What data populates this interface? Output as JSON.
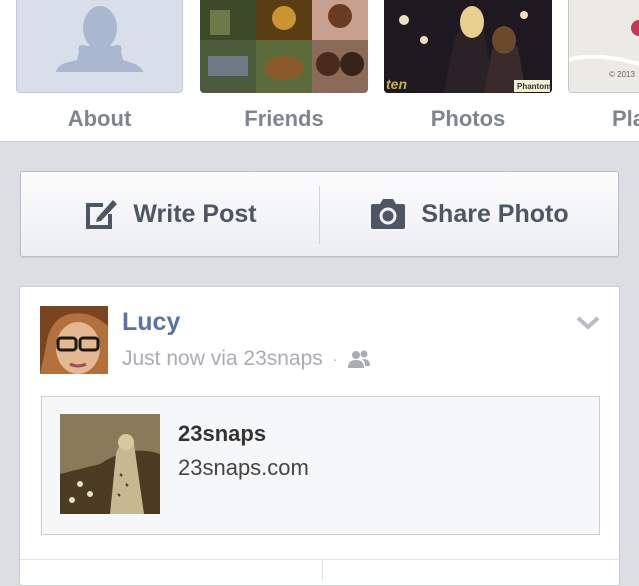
{
  "tiles": {
    "about_label": "About",
    "friends_label": "Friends",
    "photos_label": "Photos",
    "places_label": "Pla",
    "map_copyright": "© 2013",
    "photo_watermark_left": "ten",
    "photo_watermark_right": "Phantom"
  },
  "actions": {
    "write_post_label": "Write Post",
    "share_photo_label": "Share Photo"
  },
  "story": {
    "author": "Lucy",
    "meta_time": "Just now via 23snaps",
    "meta_dot": "·",
    "attachment": {
      "title": "23snaps",
      "domain": "23snaps.com"
    }
  },
  "colors": {
    "page_bg": "#dcdee3",
    "link_blue": "#5b72a5",
    "meta_grey": "#a9acb3",
    "label_grey": "#7f8590"
  }
}
